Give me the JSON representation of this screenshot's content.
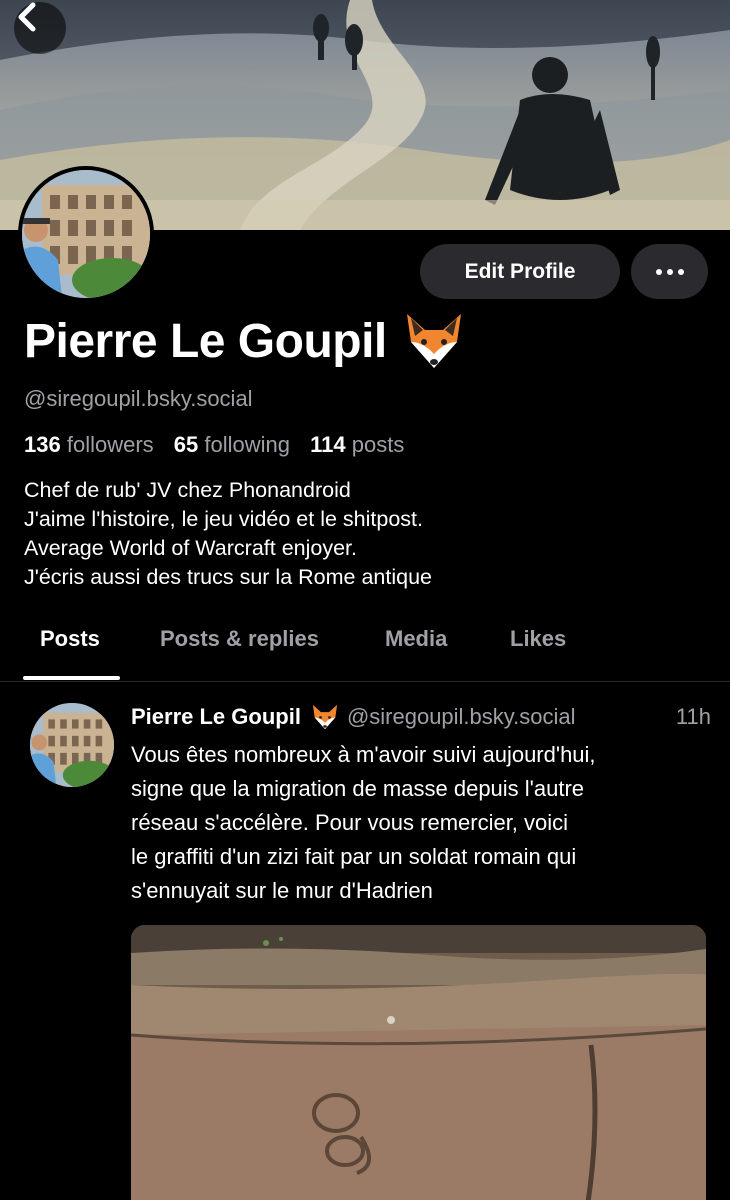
{
  "profile": {
    "name": "Pierre Le Goupil",
    "handle": "@siregoupil.bsky.social",
    "followers_count": "136",
    "followers_label": "followers",
    "following_count": "65",
    "following_label": "following",
    "posts_count": "114",
    "posts_label": "posts",
    "bio_lines": [
      "Chef de rub' JV chez Phonandroid",
      "J'aime l'histoire, le jeu vidéo et le shitpost.",
      "Average World of Warcraft enjoyer.",
      "J'écris aussi des trucs sur la Rome antique"
    ]
  },
  "actions": {
    "edit_profile_label": "Edit Profile",
    "more_icon": "ellipsis-icon",
    "back_icon": "chevron-left-icon"
  },
  "tabs": [
    {
      "label": "Posts",
      "active": true
    },
    {
      "label": "Posts & replies",
      "active": false
    },
    {
      "label": "Media",
      "active": false
    },
    {
      "label": "Likes",
      "active": false
    }
  ],
  "post": {
    "author": "Pierre Le Goupil",
    "handle": "@siregoupil.bsky.social",
    "time": "11h",
    "text_lines": [
      "Vous êtes nombreux à m'avoir suivi aujourd'hui,",
      "signe que la migration de masse depuis l'autre",
      "réseau s'accélère. Pour vous remercier, voici",
      "le graffiti d'un zizi fait par un soldat romain qui",
      "s'ennuyait sur le mur d'Hadrien"
    ]
  },
  "colors": {
    "background": "#000000",
    "button_bg": "#2b2b2f",
    "muted_text": "#a0a0a6",
    "fox_orange": "#f2862e"
  }
}
